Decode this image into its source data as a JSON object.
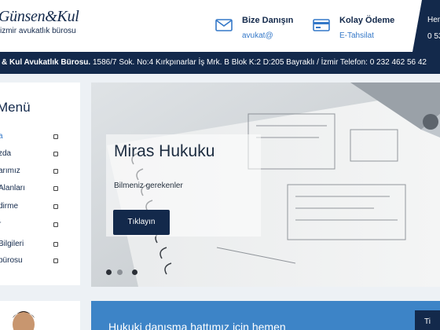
{
  "header": {
    "logo_main": "Günsen&Kul",
    "logo_sub": "izmir avukatlık bürosu",
    "contact_title": "Bize Danışın",
    "contact_email": "avukat@",
    "payment_title": "Kolay Ödeme",
    "payment_sub": "E-Tahsilat",
    "right_line1": "Hem",
    "right_line2": "0 53"
  },
  "address_bar": {
    "firm": "& Kul Avukatlık Bürosu.",
    "details": " 1586/7 Sok. No:4 Kırkpınarlar İş Mrk. B Blok K:2 D:205 Bayraklı / İzmir Telefon: 0 232 462 56 42"
  },
  "menu": {
    "title": "Menü",
    "items": [
      {
        "label": "a"
      },
      {
        "label": "zda"
      },
      {
        "label": "arımız"
      },
      {
        "label": "Alanları"
      },
      {
        "label": "dirme"
      },
      {
        "label": "r"
      },
      {
        "label": "Bilgileri"
      },
      {
        "label": "bürosu"
      }
    ]
  },
  "slider": {
    "title": "Miras Hukuku",
    "subtitle": "Bilmeniz gerekenler",
    "button": "Tıklayın"
  },
  "cta": {
    "text": "Hukuki danışma hattımız için hemen",
    "button": "Ti"
  },
  "colors": {
    "navy": "#13294b",
    "accent_blue": "#3478c8",
    "cta_blue": "#3d84c7"
  }
}
